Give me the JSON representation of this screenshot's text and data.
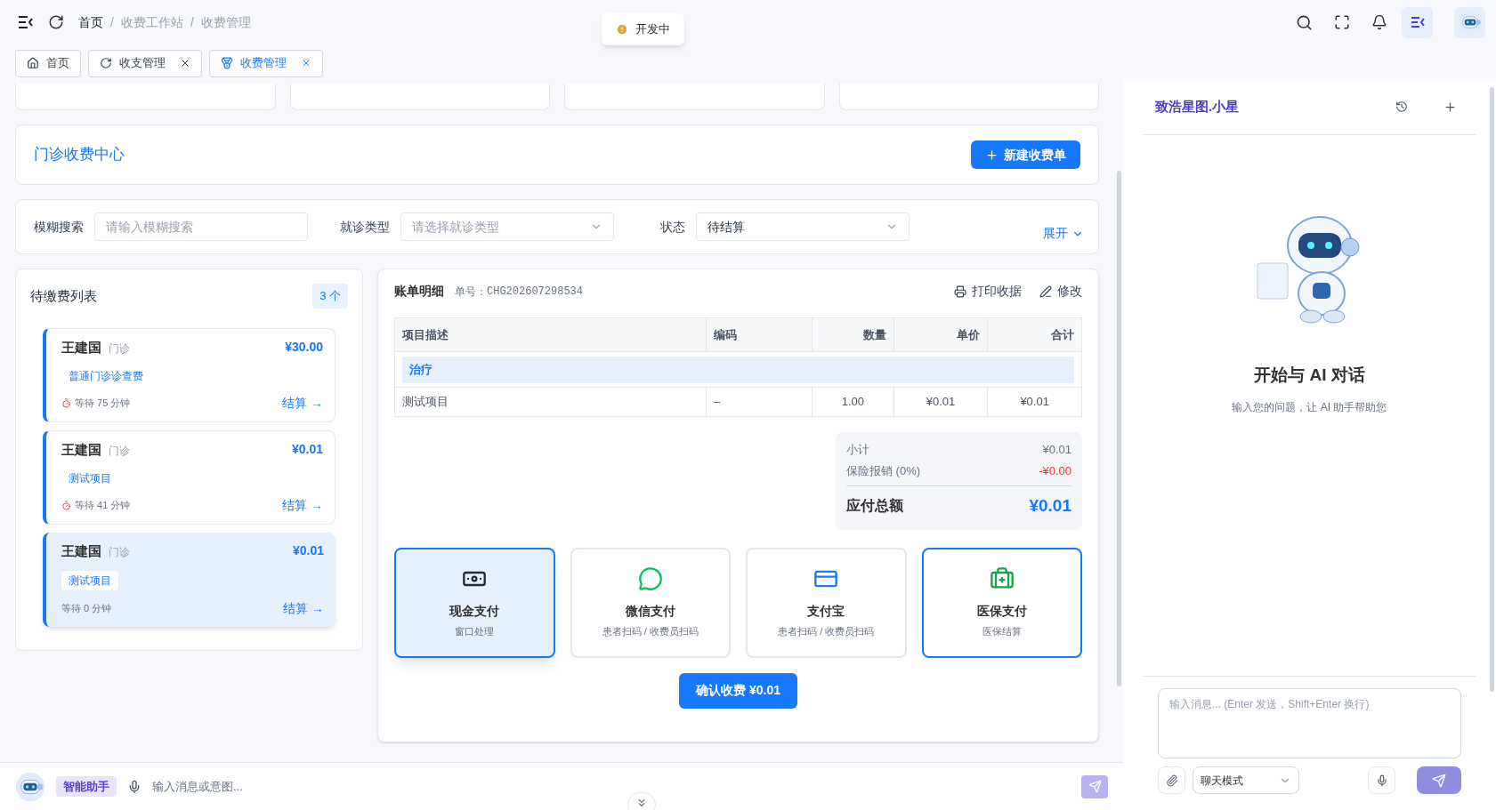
{
  "breadcrumb": [
    "首页",
    "收费工作站",
    "收费管理"
  ],
  "breadcrumb_separator": "/",
  "toast": {
    "text": "开发中"
  },
  "tabs": [
    {
      "label": "首页",
      "selected": false,
      "closable": false,
      "kind": "home"
    },
    {
      "label": "收支管理",
      "selected": false,
      "closable": true,
      "kind": "finance"
    },
    {
      "label": "收费管理",
      "selected": true,
      "closable": true,
      "kind": "fee"
    }
  ],
  "header": {
    "title": "门诊收费中心",
    "new_button": "新建收费单"
  },
  "filters": {
    "search_label": "模糊搜索",
    "search_placeholder": "请输入模糊搜索",
    "type_label": "就诊类型",
    "type_placeholder": "请选择就诊类型",
    "status_label": "状态",
    "status_value": "待结算",
    "expand": "展开"
  },
  "pending": {
    "title": "待缴费列表",
    "count": "3 个",
    "items": [
      {
        "name": "王建国",
        "type": "门诊",
        "amount": "¥30.00",
        "item": "普通门诊诊查费",
        "wait": "等待 75 分钟",
        "action": "结算 →",
        "overdue": true,
        "selected": false
      },
      {
        "name": "王建国",
        "type": "门诊",
        "amount": "¥0.01",
        "item": "测试项目",
        "wait": "等待 41 分钟",
        "action": "结算 →",
        "overdue": true,
        "selected": false
      },
      {
        "name": "王建国",
        "type": "门诊",
        "amount": "¥0.01",
        "item": "测试项目",
        "wait": "等待 0 分钟",
        "action": "结算 →",
        "overdue": false,
        "selected": true
      }
    ]
  },
  "bill": {
    "title": "账单明细",
    "number_label": "单号：",
    "number": "CHG202607298534",
    "print": "打印收据",
    "edit": "修改",
    "columns": [
      "项目描述",
      "编码",
      "数量",
      "单价",
      "合计"
    ],
    "group": "治疗",
    "rows": [
      [
        "测试项目",
        "–",
        "1.00",
        "¥0.01",
        "¥0.01"
      ]
    ],
    "summary": {
      "subtotal_label": "小计",
      "subtotal": "¥0.01",
      "insurance_label": "保险报销 (0%)",
      "insurance": "-¥0.00",
      "total_label": "应付总额",
      "total": "¥0.01"
    },
    "payments": [
      {
        "kind": "cash",
        "title": "现金支付",
        "sub": "窗口处理",
        "selected": true,
        "highlighted": true
      },
      {
        "kind": "wechat",
        "title": "微信支付",
        "sub": "患者扫码 / 收费员扫码",
        "selected": false,
        "highlighted": false
      },
      {
        "kind": "alipay",
        "title": "支付宝",
        "sub": "患者扫码 / 收费员扫码",
        "selected": false,
        "highlighted": false
      },
      {
        "kind": "insurance",
        "title": "医保支付",
        "sub": "医保结算",
        "selected": false,
        "highlighted": true
      }
    ],
    "confirm": "确认收费 ¥0.01"
  },
  "assistant_bar": {
    "badge": "智能助手",
    "placeholder": "输入消息或意图..."
  },
  "chat": {
    "title": "致浩星图.小星",
    "heading": "开始与 AI 对话",
    "subtitle": "输入您的问题，让 AI 助手帮助您",
    "placeholder": "输入消息... (Enter 发送，Shift+Enter 换行)",
    "mode": "聊天模式"
  }
}
